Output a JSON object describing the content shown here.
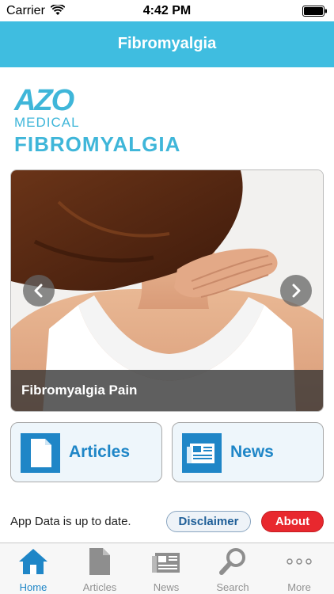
{
  "status_bar": {
    "carrier": "Carrier",
    "time": "4:42 PM",
    "icons": [
      "wifi-icon",
      "battery-icon"
    ]
  },
  "nav": {
    "title": "Fibromyalgia"
  },
  "logo": {
    "brand": "AZO",
    "sub_brand": "MEDICAL",
    "topic": "FIBROMYALGIA"
  },
  "carousel": {
    "caption": "Fibromyalgia Pain",
    "prev_icon": "chevron-left-icon",
    "next_icon": "chevron-right-icon"
  },
  "buttons": {
    "articles": {
      "label": "Articles",
      "icon": "document-icon"
    },
    "news": {
      "label": "News",
      "icon": "newspaper-icon"
    }
  },
  "footer": {
    "status_text": "App Data is up to date.",
    "disclaimer_label": "Disclaimer",
    "about_label": "About"
  },
  "tabs": [
    {
      "label": "Home",
      "icon": "home-icon",
      "active": true
    },
    {
      "label": "Articles",
      "icon": "document-icon",
      "active": false
    },
    {
      "label": "News",
      "icon": "newspaper-icon",
      "active": false
    },
    {
      "label": "Search",
      "icon": "search-icon",
      "active": false
    },
    {
      "label": "More",
      "icon": "more-icon",
      "active": false
    }
  ],
  "colors": {
    "accent": "#3fbde0",
    "button_blue": "#1f86c7",
    "about_red": "#e8282e"
  }
}
